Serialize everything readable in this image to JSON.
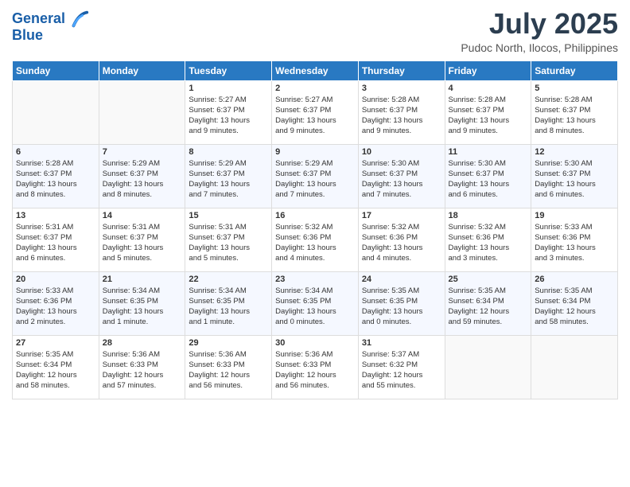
{
  "header": {
    "logo_line1": "General",
    "logo_line2": "Blue",
    "title": "July 2025",
    "location": "Pudoc North, Ilocos, Philippines"
  },
  "days_of_week": [
    "Sunday",
    "Monday",
    "Tuesday",
    "Wednesday",
    "Thursday",
    "Friday",
    "Saturday"
  ],
  "weeks": [
    {
      "days": [
        {
          "num": "",
          "info": ""
        },
        {
          "num": "",
          "info": ""
        },
        {
          "num": "1",
          "info": "Sunrise: 5:27 AM\nSunset: 6:37 PM\nDaylight: 13 hours\nand 9 minutes."
        },
        {
          "num": "2",
          "info": "Sunrise: 5:27 AM\nSunset: 6:37 PM\nDaylight: 13 hours\nand 9 minutes."
        },
        {
          "num": "3",
          "info": "Sunrise: 5:28 AM\nSunset: 6:37 PM\nDaylight: 13 hours\nand 9 minutes."
        },
        {
          "num": "4",
          "info": "Sunrise: 5:28 AM\nSunset: 6:37 PM\nDaylight: 13 hours\nand 9 minutes."
        },
        {
          "num": "5",
          "info": "Sunrise: 5:28 AM\nSunset: 6:37 PM\nDaylight: 13 hours\nand 8 minutes."
        }
      ]
    },
    {
      "days": [
        {
          "num": "6",
          "info": "Sunrise: 5:28 AM\nSunset: 6:37 PM\nDaylight: 13 hours\nand 8 minutes."
        },
        {
          "num": "7",
          "info": "Sunrise: 5:29 AM\nSunset: 6:37 PM\nDaylight: 13 hours\nand 8 minutes."
        },
        {
          "num": "8",
          "info": "Sunrise: 5:29 AM\nSunset: 6:37 PM\nDaylight: 13 hours\nand 7 minutes."
        },
        {
          "num": "9",
          "info": "Sunrise: 5:29 AM\nSunset: 6:37 PM\nDaylight: 13 hours\nand 7 minutes."
        },
        {
          "num": "10",
          "info": "Sunrise: 5:30 AM\nSunset: 6:37 PM\nDaylight: 13 hours\nand 7 minutes."
        },
        {
          "num": "11",
          "info": "Sunrise: 5:30 AM\nSunset: 6:37 PM\nDaylight: 13 hours\nand 6 minutes."
        },
        {
          "num": "12",
          "info": "Sunrise: 5:30 AM\nSunset: 6:37 PM\nDaylight: 13 hours\nand 6 minutes."
        }
      ]
    },
    {
      "days": [
        {
          "num": "13",
          "info": "Sunrise: 5:31 AM\nSunset: 6:37 PM\nDaylight: 13 hours\nand 6 minutes."
        },
        {
          "num": "14",
          "info": "Sunrise: 5:31 AM\nSunset: 6:37 PM\nDaylight: 13 hours\nand 5 minutes."
        },
        {
          "num": "15",
          "info": "Sunrise: 5:31 AM\nSunset: 6:37 PM\nDaylight: 13 hours\nand 5 minutes."
        },
        {
          "num": "16",
          "info": "Sunrise: 5:32 AM\nSunset: 6:36 PM\nDaylight: 13 hours\nand 4 minutes."
        },
        {
          "num": "17",
          "info": "Sunrise: 5:32 AM\nSunset: 6:36 PM\nDaylight: 13 hours\nand 4 minutes."
        },
        {
          "num": "18",
          "info": "Sunrise: 5:32 AM\nSunset: 6:36 PM\nDaylight: 13 hours\nand 3 minutes."
        },
        {
          "num": "19",
          "info": "Sunrise: 5:33 AM\nSunset: 6:36 PM\nDaylight: 13 hours\nand 3 minutes."
        }
      ]
    },
    {
      "days": [
        {
          "num": "20",
          "info": "Sunrise: 5:33 AM\nSunset: 6:36 PM\nDaylight: 13 hours\nand 2 minutes."
        },
        {
          "num": "21",
          "info": "Sunrise: 5:34 AM\nSunset: 6:35 PM\nDaylight: 13 hours\nand 1 minute."
        },
        {
          "num": "22",
          "info": "Sunrise: 5:34 AM\nSunset: 6:35 PM\nDaylight: 13 hours\nand 1 minute."
        },
        {
          "num": "23",
          "info": "Sunrise: 5:34 AM\nSunset: 6:35 PM\nDaylight: 13 hours\nand 0 minutes."
        },
        {
          "num": "24",
          "info": "Sunrise: 5:35 AM\nSunset: 6:35 PM\nDaylight: 13 hours\nand 0 minutes."
        },
        {
          "num": "25",
          "info": "Sunrise: 5:35 AM\nSunset: 6:34 PM\nDaylight: 12 hours\nand 59 minutes."
        },
        {
          "num": "26",
          "info": "Sunrise: 5:35 AM\nSunset: 6:34 PM\nDaylight: 12 hours\nand 58 minutes."
        }
      ]
    },
    {
      "days": [
        {
          "num": "27",
          "info": "Sunrise: 5:35 AM\nSunset: 6:34 PM\nDaylight: 12 hours\nand 58 minutes."
        },
        {
          "num": "28",
          "info": "Sunrise: 5:36 AM\nSunset: 6:33 PM\nDaylight: 12 hours\nand 57 minutes."
        },
        {
          "num": "29",
          "info": "Sunrise: 5:36 AM\nSunset: 6:33 PM\nDaylight: 12 hours\nand 56 minutes."
        },
        {
          "num": "30",
          "info": "Sunrise: 5:36 AM\nSunset: 6:33 PM\nDaylight: 12 hours\nand 56 minutes."
        },
        {
          "num": "31",
          "info": "Sunrise: 5:37 AM\nSunset: 6:32 PM\nDaylight: 12 hours\nand 55 minutes."
        },
        {
          "num": "",
          "info": ""
        },
        {
          "num": "",
          "info": ""
        }
      ]
    }
  ]
}
